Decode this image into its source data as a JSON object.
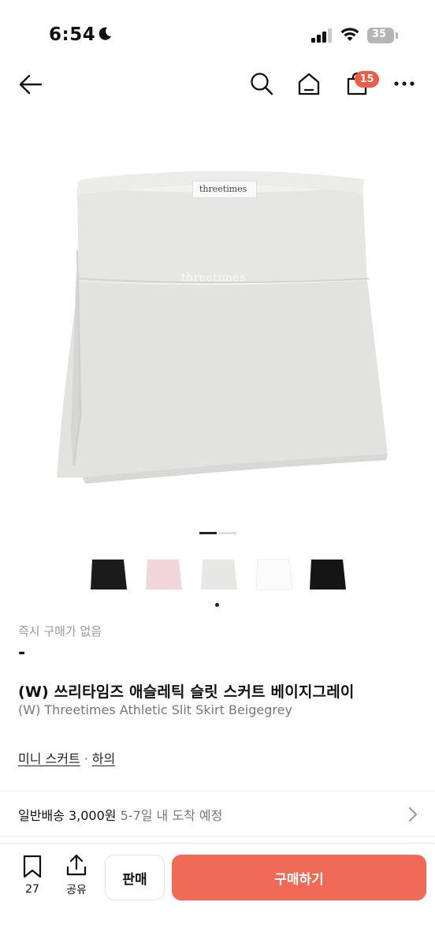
{
  "status_bar": {
    "time": "6:54",
    "battery": "35"
  },
  "nav": {
    "cart_count": "15"
  },
  "product": {
    "brand_label": "threetimes",
    "instant_purchase_note": "즉시 구매가 없음",
    "price": "-",
    "title_ko": "(W) 쓰리타임즈 애슬레틱 슬릿 스커트 베이지그레이",
    "title_en": "(W) Threetimes Athletic Slit Skirt Beigegrey",
    "gallery": {
      "page_count": 2,
      "active_page": 1
    },
    "thumbnails": [
      {
        "name": "black",
        "color": "#1b1b1b"
      },
      {
        "name": "pink",
        "color": "#f1d7da"
      },
      {
        "name": "beigegrey",
        "color": "#e7e7e6"
      },
      {
        "name": "white",
        "color": "#fbfbfb"
      },
      {
        "name": "black-2",
        "color": "#151515"
      }
    ],
    "selected_thumbnail": 2
  },
  "categories": {
    "primary": "미니 스커트",
    "separator": "·",
    "secondary": "하의"
  },
  "shipping": {
    "label": "일반배송",
    "fee": "3,000원",
    "eta": "5-7일 내 도착 예정"
  },
  "bottom_bar": {
    "like_count": "27",
    "share_label": "공유",
    "sell_label": "판매",
    "buy_label": "구매하기"
  },
  "colors": {
    "accent": "#f06a56",
    "badge": "#f05a48"
  }
}
